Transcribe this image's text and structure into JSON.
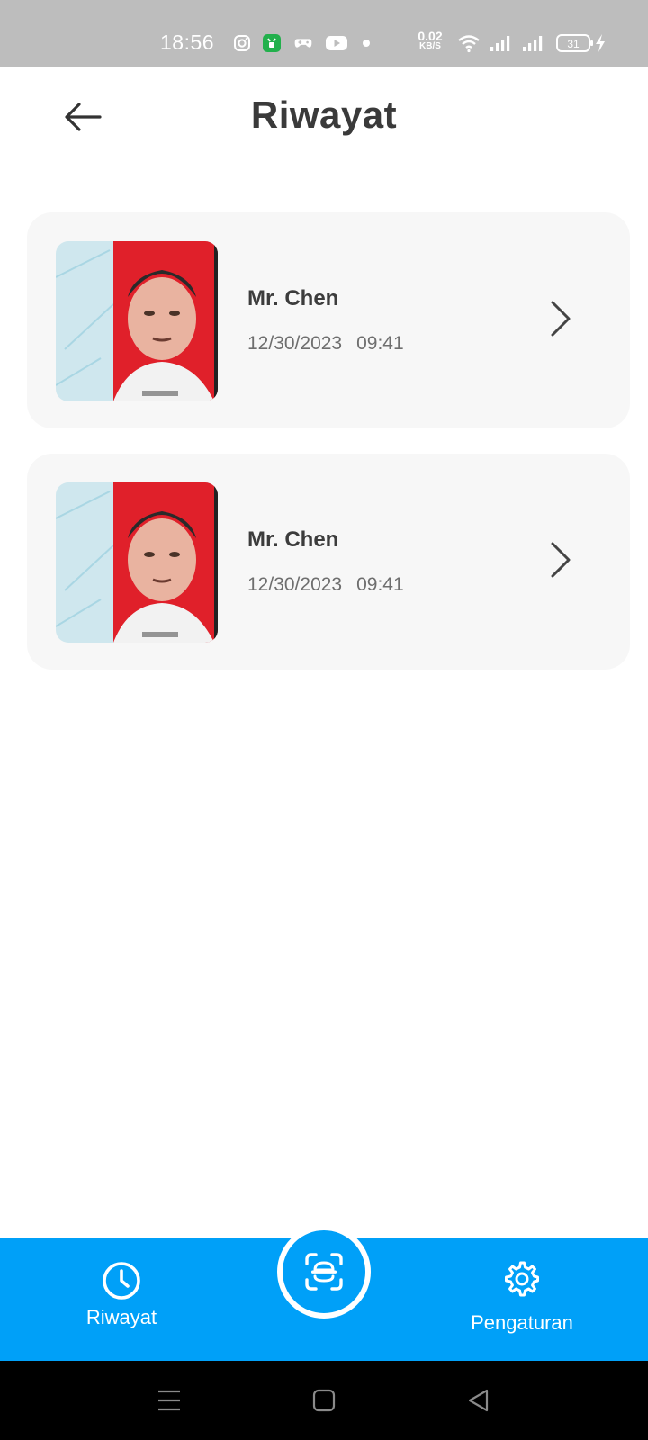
{
  "status_bar": {
    "time": "18:56",
    "net_speed_value": "0.02",
    "net_speed_unit": "KB/S",
    "battery_level": "31",
    "icons": [
      "instagram-icon",
      "app-store-icon",
      "game-controller-icon",
      "youtube-icon",
      "dot-icon",
      "wifi-icon",
      "signal-icon",
      "signal-icon",
      "battery-icon",
      "charging-icon"
    ]
  },
  "header": {
    "title": "Riwayat",
    "back_icon": "arrow-left-icon"
  },
  "history": [
    {
      "name": "Mr. Chen",
      "date": "12/30/2023",
      "time": "09:41",
      "icon": "chevron-right-icon"
    },
    {
      "name": "Mr. Chen",
      "date": "12/30/2023",
      "time": "09:41",
      "icon": "chevron-right-icon"
    }
  ],
  "bottom_nav": {
    "history_label": "Riwayat",
    "history_icon": "clock-icon",
    "scan_icon": "scan-icon",
    "settings_label": "Pengaturan",
    "settings_icon": "gear-icon"
  },
  "colors": {
    "accent": "#00A0F8",
    "card_bg": "#F7F7F7",
    "status_bar_bg": "#BDBDBD",
    "title_text": "#3A3A3A",
    "secondary_text": "#6E6E6E"
  }
}
